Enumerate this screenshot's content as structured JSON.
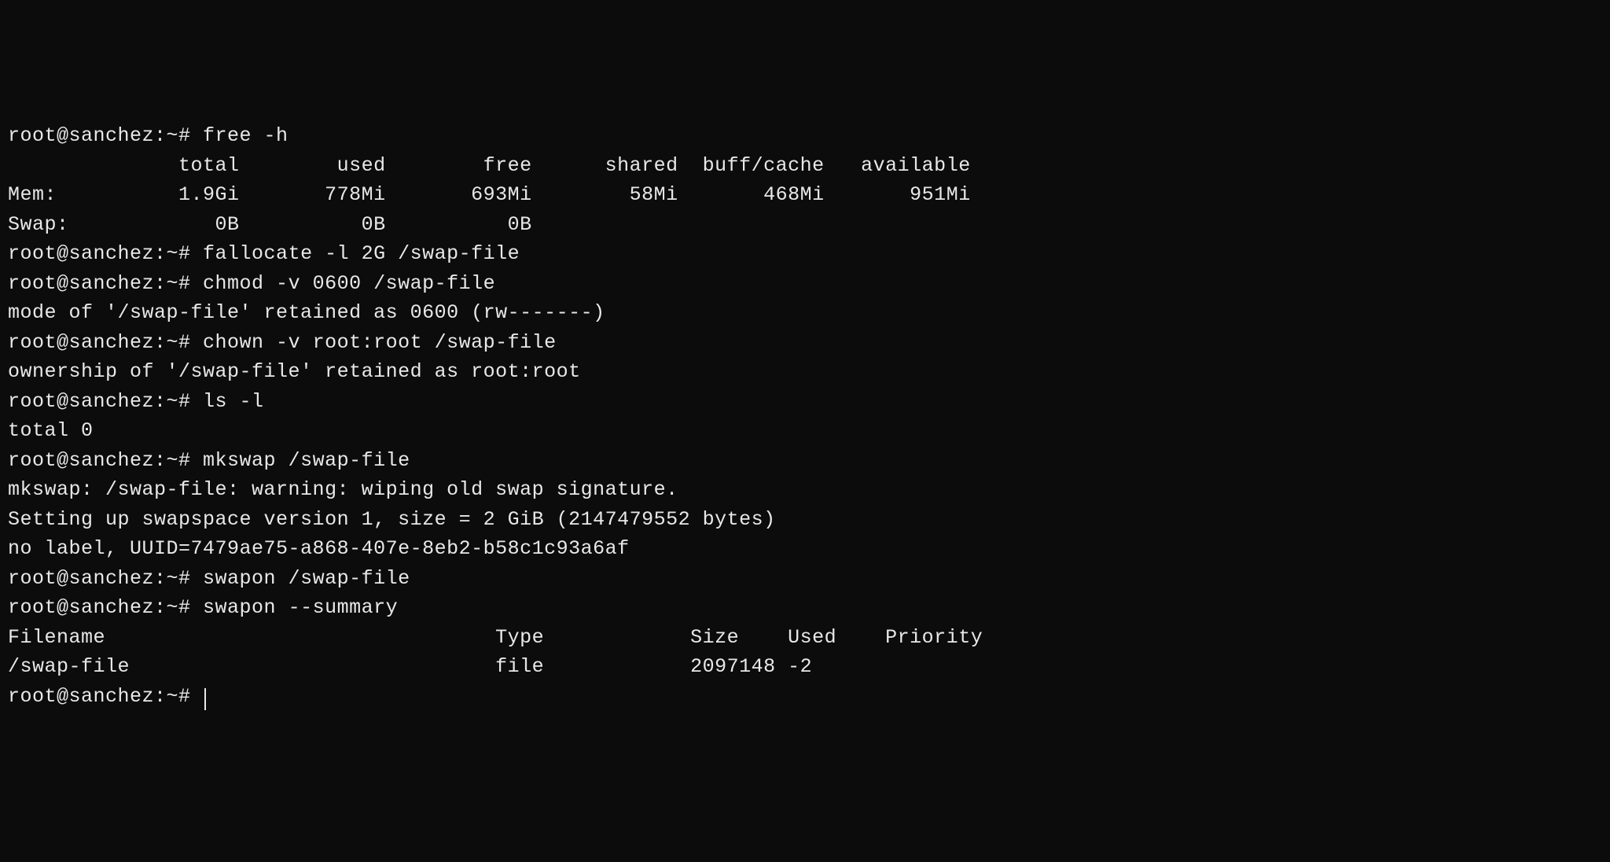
{
  "prompt": "root@sanchez:~# ",
  "session": {
    "cmd_free": "free -h",
    "free_header": "              total        used        free      shared  buff/cache   available",
    "free_mem": "Mem:          1.9Gi       778Mi       693Mi        58Mi       468Mi       951Mi",
    "free_swap": "Swap:            0B          0B          0B",
    "cmd_fallocate": "fallocate -l 2G /swap-file",
    "cmd_chmod": "chmod -v 0600 /swap-file",
    "chmod_out": "mode of '/swap-file' retained as 0600 (rw-------)",
    "cmd_chown": "chown -v root:root /swap-file",
    "chown_out": "ownership of '/swap-file' retained as root:root",
    "cmd_ls": "ls -l",
    "ls_out": "total 0",
    "cmd_mkswap": "mkswap /swap-file",
    "mkswap_out1": "mkswap: /swap-file: warning: wiping old swap signature.",
    "mkswap_out2": "Setting up swapspace version 1, size = 2 GiB (2147479552 bytes)",
    "mkswap_out3": "no label, UUID=7479ae75-a868-407e-8eb2-b58c1c93a6af",
    "cmd_swapon": "swapon /swap-file",
    "cmd_swapon_summary": "swapon --summary",
    "swapon_header": "Filename                                Type            Size    Used    Priority",
    "swapon_row": "/swap-file                              file            2097148 -2",
    "cmd_empty": ""
  }
}
